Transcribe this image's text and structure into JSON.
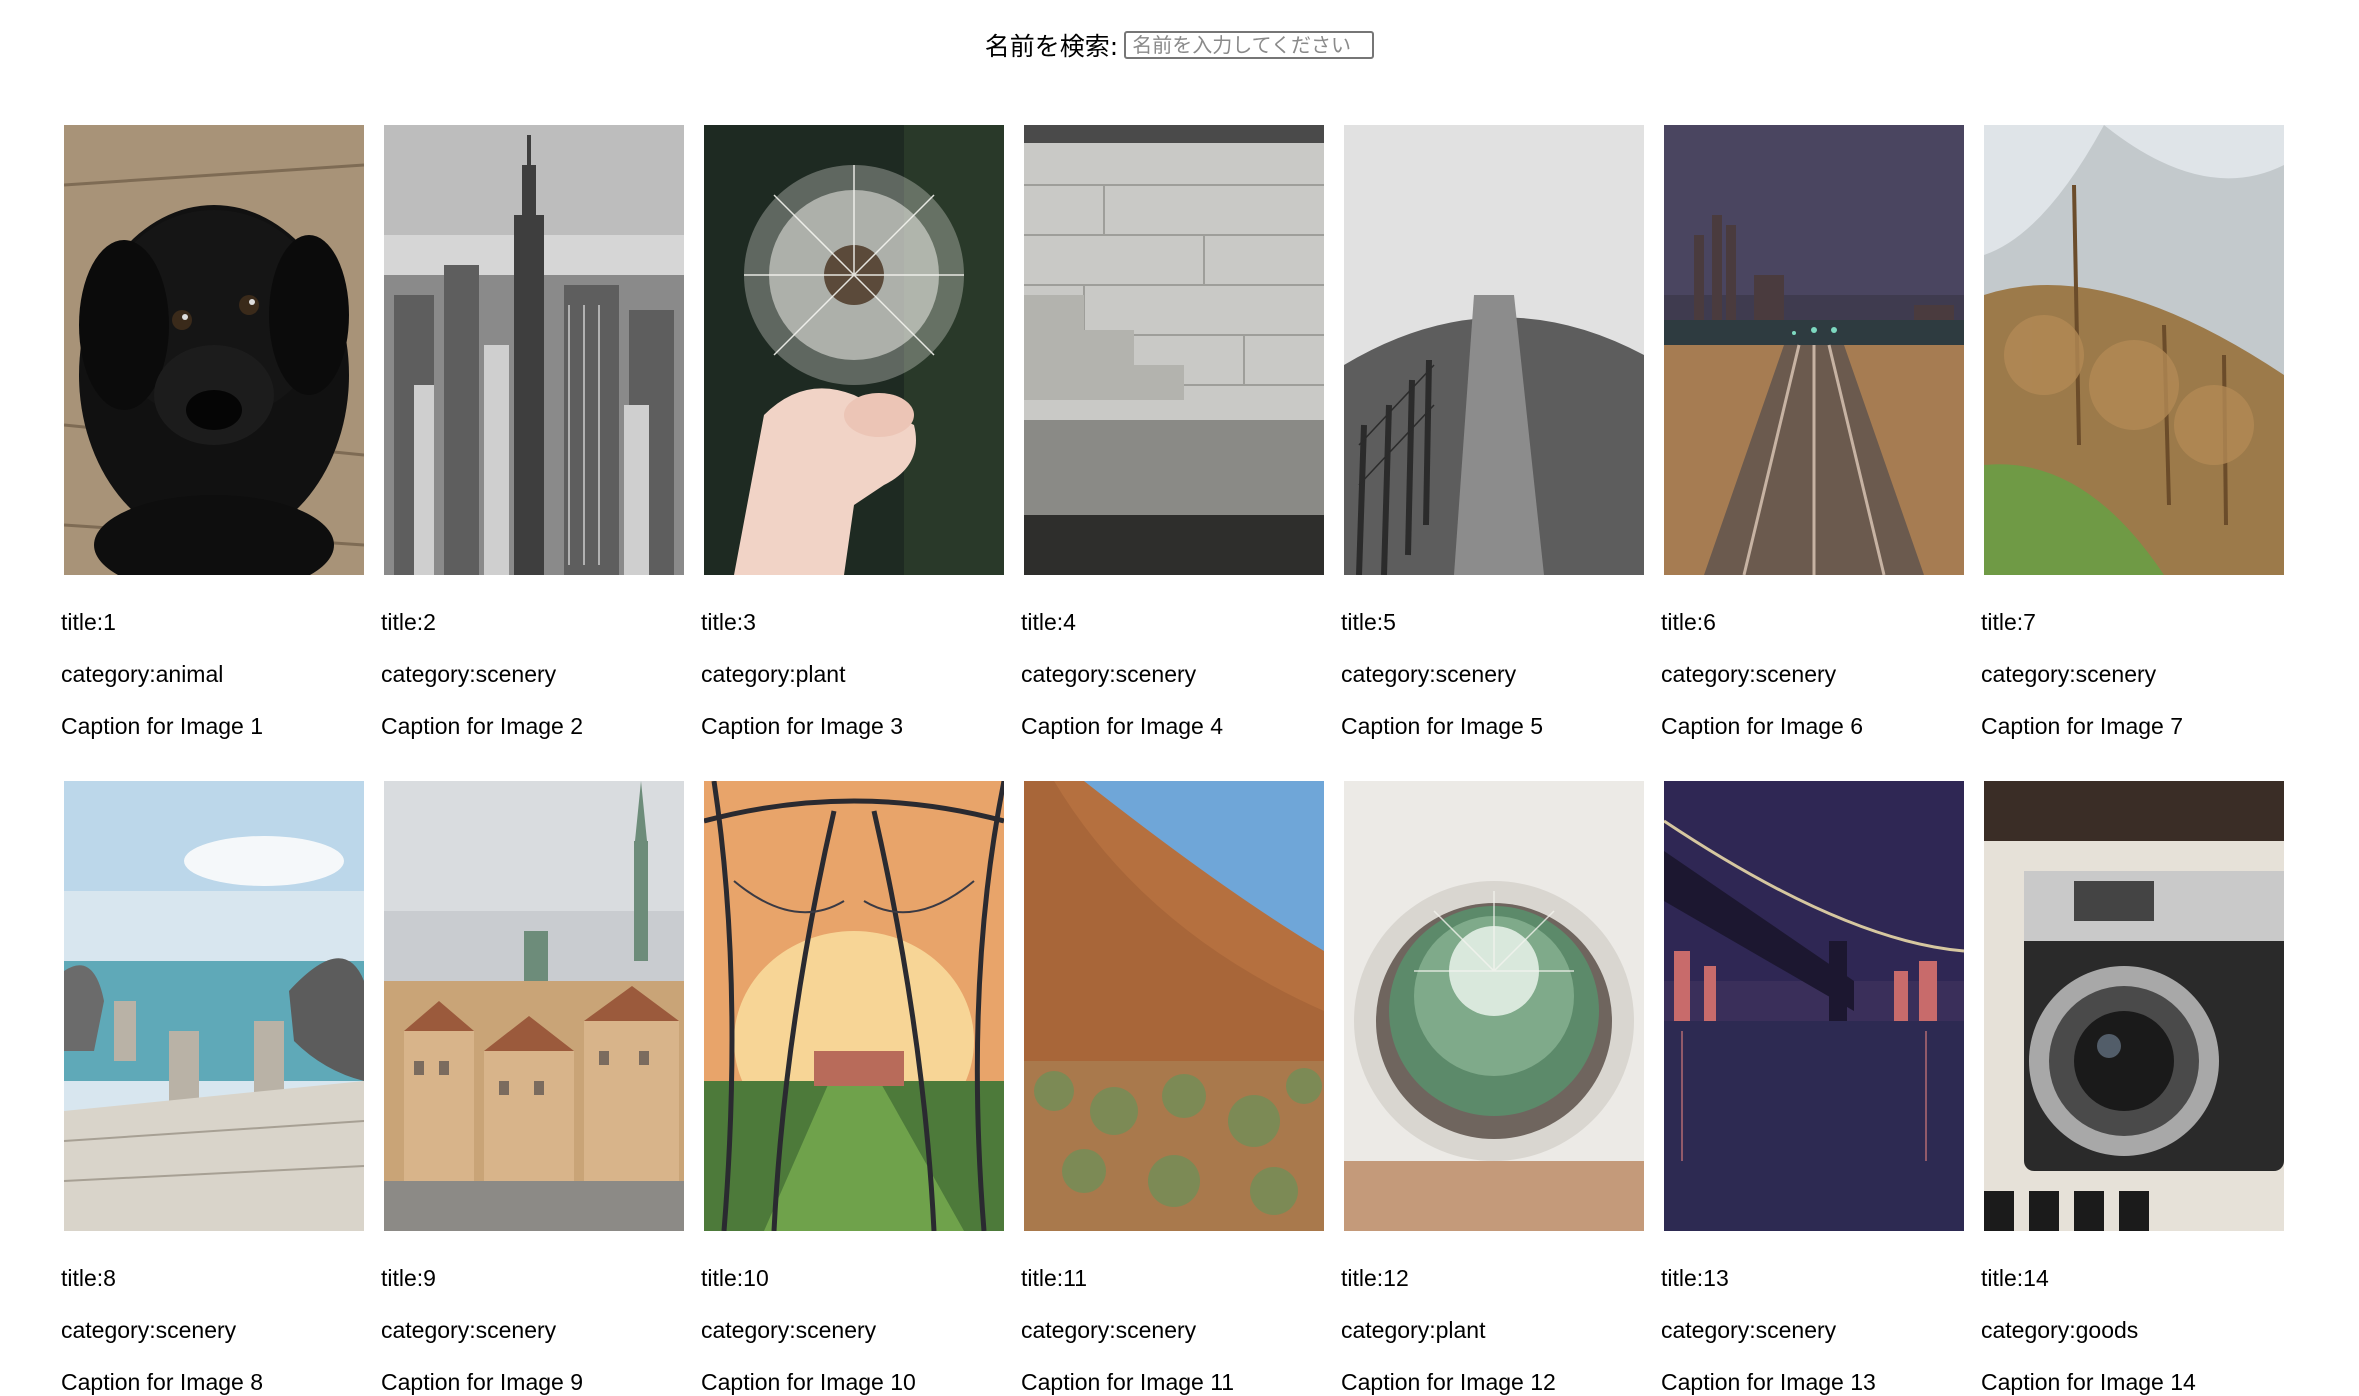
{
  "search": {
    "label": "名前を検索:",
    "placeholder": "名前を入力してください",
    "value": ""
  },
  "images": [
    {
      "title": "title:1",
      "category": "category:animal",
      "caption": "Caption for Image 1",
      "subject": "black puppy on wooden deck",
      "icon": "puppy-photo"
    },
    {
      "title": "title:2",
      "category": "category:scenery",
      "caption": "Caption for Image 2",
      "subject": "black and white city skyline",
      "icon": "city-skyline-photo"
    },
    {
      "title": "title:3",
      "category": "category:plant",
      "caption": "Caption for Image 3",
      "subject": "hand holding dandelion",
      "icon": "dandelion-photo"
    },
    {
      "title": "title:4",
      "category": "category:scenery",
      "caption": "Caption for Image 4",
      "subject": "stone wall steps by water",
      "icon": "stone-wall-photo"
    },
    {
      "title": "title:5",
      "category": "category:scenery",
      "caption": "Caption for Image 5",
      "subject": "hill path with fence",
      "icon": "hill-path-photo"
    },
    {
      "title": "title:6",
      "category": "category:scenery",
      "caption": "Caption for Image 6",
      "subject": "railway tracks at dusk",
      "icon": "railway-photo"
    },
    {
      "title": "title:7",
      "category": "category:scenery",
      "caption": "Caption for Image 7",
      "subject": "misty mountain forest",
      "icon": "forest-mountain-photo"
    },
    {
      "title": "title:8",
      "category": "category:scenery",
      "caption": "Caption for Image 8",
      "subject": "pelicans on pier",
      "icon": "pier-pelican-photo"
    },
    {
      "title": "title:9",
      "category": "category:scenery",
      "caption": "Caption for Image 9",
      "subject": "old town with spires",
      "icon": "old-town-photo"
    },
    {
      "title": "title:10",
      "category": "category:scenery",
      "caption": "Caption for Image 10",
      "subject": "tree tunnel at sunset",
      "icon": "tree-tunnel-photo"
    },
    {
      "title": "title:11",
      "category": "category:scenery",
      "caption": "Caption for Image 11",
      "subject": "red rock desert",
      "icon": "red-rock-photo"
    },
    {
      "title": "title:12",
      "category": "category:plant",
      "caption": "Caption for Image 12",
      "subject": "potted cactus from above",
      "icon": "cactus-photo"
    },
    {
      "title": "title:13",
      "category": "category:scenery",
      "caption": "Caption for Image 13",
      "subject": "bridge over river at night",
      "icon": "night-bridge-photo"
    },
    {
      "title": "title:14",
      "category": "category:goods",
      "caption": "Caption for Image 14",
      "subject": "vintage camera",
      "icon": "camera-photo"
    }
  ]
}
